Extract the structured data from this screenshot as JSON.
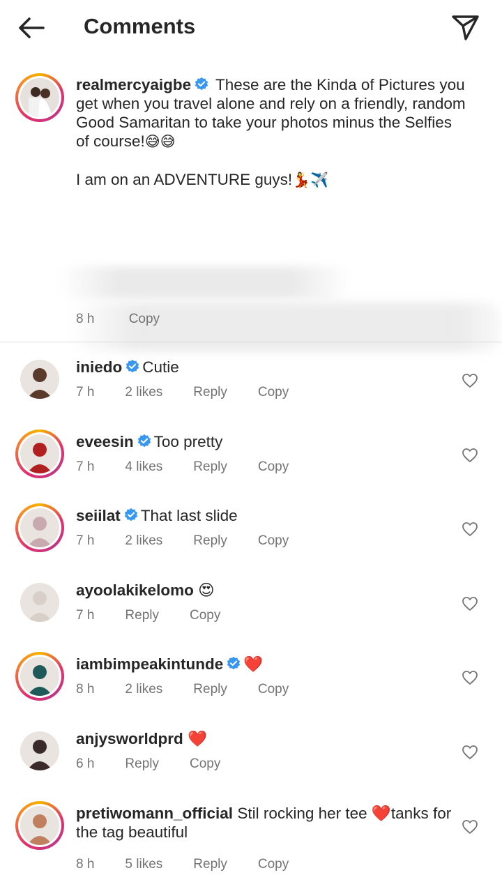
{
  "header": {
    "title": "Comments",
    "back_icon": "arrow-left-icon",
    "send_icon": "paper-plane-icon"
  },
  "caption": {
    "username": "realmercyaigbe",
    "verified": true,
    "text": "These are the Kinda of Pictures you get when you travel alone and rely on a friendly, random Good Samaritan to take your photos minus the Selfies of course!",
    "text_emoji": "😅😅",
    "line2": "I am on an ADVENTURE guys!",
    "line2_emoji": "💃✈️",
    "time": "8 h",
    "copy": "Copy"
  },
  "comments": [
    {
      "username": "iniedo",
      "verified": true,
      "text": "Cutie",
      "time": "7 h",
      "likes": "2 likes",
      "reply": "Reply",
      "copy": "Copy",
      "ring": false,
      "avatar_color": "#5a3a2a"
    },
    {
      "username": "eveesin",
      "verified": true,
      "text": "Too pretty",
      "time": "7 h",
      "likes": "4 likes",
      "reply": "Reply",
      "copy": "Copy",
      "ring": true,
      "avatar_color": "#b02020"
    },
    {
      "username": "seiilat",
      "verified": true,
      "text": "That last slide",
      "time": "7 h",
      "likes": "2 likes",
      "reply": "Reply",
      "copy": "Copy",
      "ring": true,
      "avatar_color": "#c9a9b0"
    },
    {
      "username": "ayoolakikelomo",
      "verified": false,
      "text": "😍",
      "time": "7 h",
      "likes": "",
      "reply": "Reply",
      "copy": "Copy",
      "ring": false,
      "avatar_color": "#d8d0c8"
    },
    {
      "username": "iambimpeakintunde",
      "verified": true,
      "text": "❤️",
      "time": "8 h",
      "likes": "2 likes",
      "reply": "Reply",
      "copy": "Copy",
      "ring": true,
      "avatar_color": "#1f5a5a"
    },
    {
      "username": "anjysworldprd",
      "verified": false,
      "text": "❤️",
      "time": "6 h",
      "likes": "",
      "reply": "Reply",
      "copy": "Copy",
      "ring": false,
      "avatar_color": "#3a2a2a"
    },
    {
      "username": "pretiwomann_official",
      "verified": false,
      "text": "Stil rocking her tee ❤️tanks for the tag beautiful",
      "time": "8 h",
      "likes": "5 likes",
      "reply": "Reply",
      "copy": "Copy",
      "ring": true,
      "avatar_color": "#c08060"
    }
  ],
  "colors": {
    "verified_blue": "#3897f0",
    "meta_gray": "#737373",
    "heart_red": "#ed1c24"
  }
}
